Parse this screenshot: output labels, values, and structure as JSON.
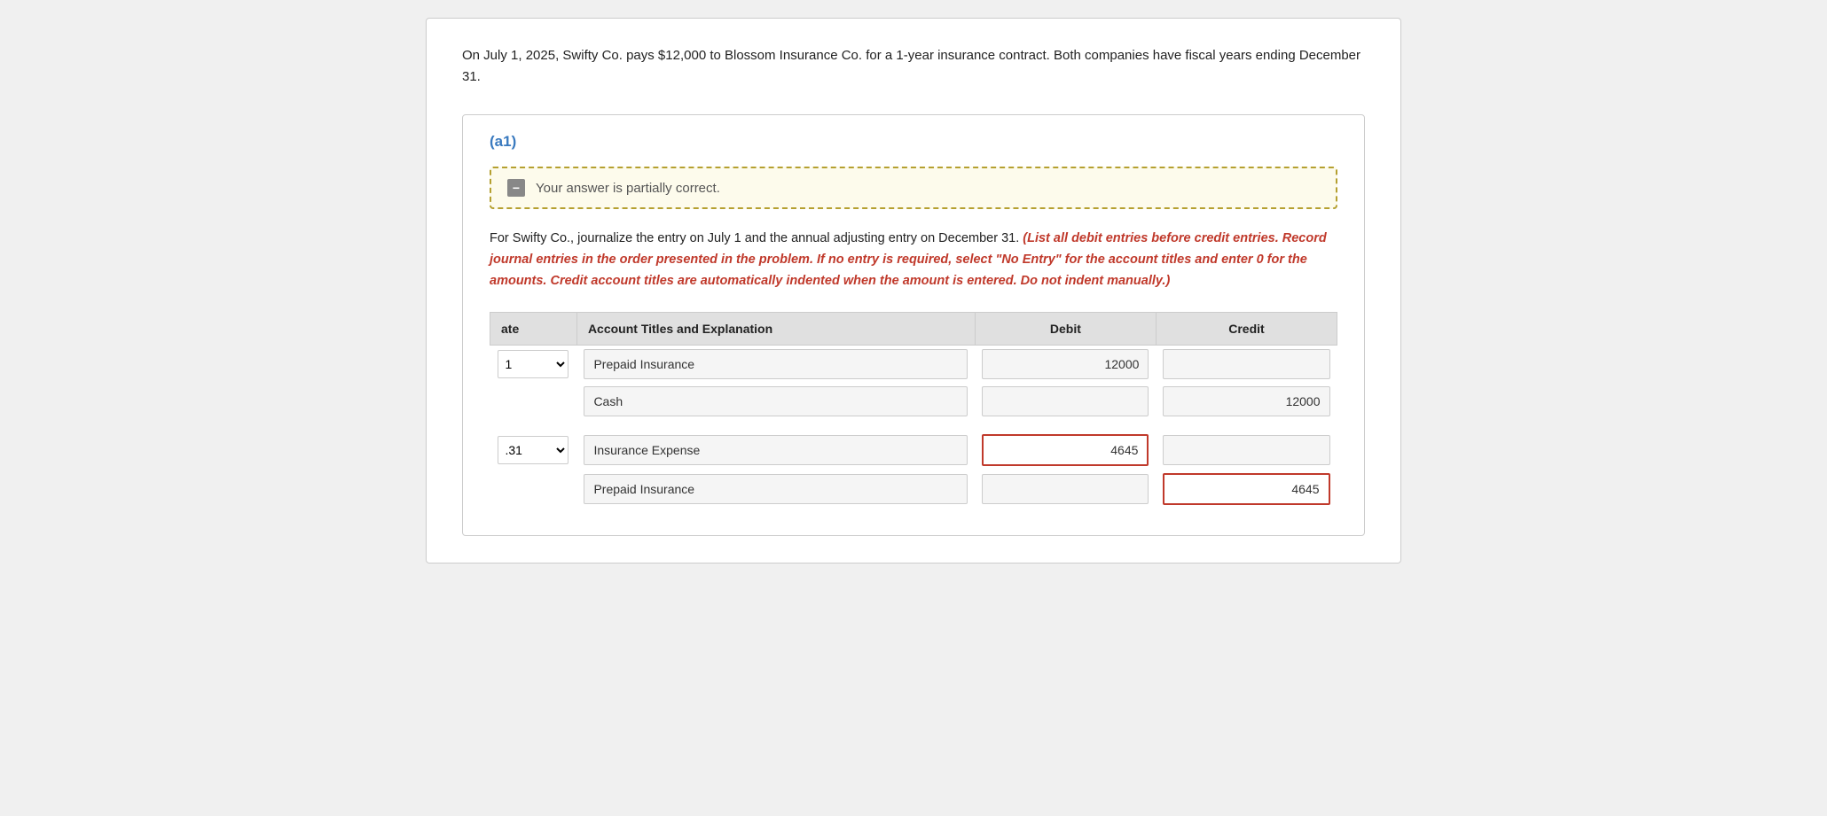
{
  "problem": {
    "text": "On July 1, 2025, Swifty Co. pays $12,000 to Blossom Insurance Co. for a 1-year insurance contract. Both companies have fiscal years ending December 31."
  },
  "section": {
    "label": "(a1)"
  },
  "partial_correct": {
    "message": "Your answer is partially correct."
  },
  "instruction": {
    "prefix": "For Swifty Co., journalize the entry on July 1 and the annual adjusting entry on December 31.",
    "italic": "(List all debit entries before credit entries. Record journal entries in the order presented in the problem. If no entry is required, select \"No Entry\" for the account titles and enter 0 for the amounts. Credit account titles are automatically indented when the amount is entered. Do not indent manually.)"
  },
  "table": {
    "headers": {
      "date": "ate",
      "account": "Account Titles and Explanation",
      "debit": "Debit",
      "credit": "Credit"
    },
    "rows": [
      {
        "date_value": "1",
        "account": "Prepaid Insurance",
        "debit": "12000",
        "credit": "",
        "debit_error": false,
        "credit_error": false
      },
      {
        "date_value": "",
        "account": "Cash",
        "debit": "",
        "credit": "12000",
        "debit_error": false,
        "credit_error": false
      },
      {
        "date_value": ".31",
        "account": "Insurance Expense",
        "debit": "4645",
        "credit": "",
        "debit_error": true,
        "credit_error": false
      },
      {
        "date_value": "",
        "account": "Prepaid Insurance",
        "debit": "",
        "credit": "4645",
        "debit_error": false,
        "credit_error": true
      }
    ]
  }
}
